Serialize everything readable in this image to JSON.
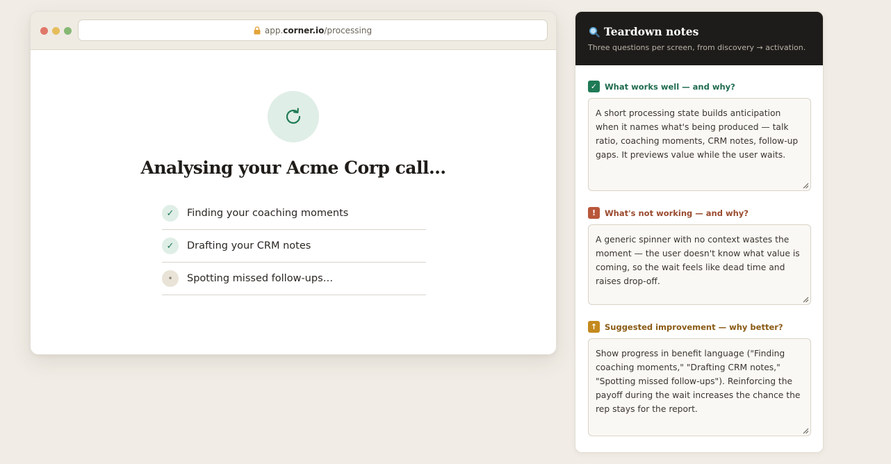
{
  "browser": {
    "url_prefix": "app.",
    "url_host": "corner.io",
    "url_path": "/processing",
    "heading": "Analysing your Acme Corp call…",
    "steps": [
      {
        "label": "Finding your coaching moments",
        "status": "done",
        "icon": "✓"
      },
      {
        "label": "Drafting your CRM notes",
        "status": "done",
        "icon": "✓"
      },
      {
        "label": "Spotting missed follow-ups…",
        "status": "pending",
        "icon": "•"
      }
    ]
  },
  "panel": {
    "title": "Teardown notes",
    "subtitle": "Three questions per screen, from discovery → activation.",
    "questions": [
      {
        "label": "What works well — and why?",
        "badge": "✓",
        "answer": "A short processing state builds anticipation when it names what's being produced — talk ratio, coaching moments, CRM notes, follow-up gaps. It previews value while the user waits."
      },
      {
        "label": "What's not working — and why?",
        "badge": "!",
        "answer": "A generic spinner with no context wastes the moment — the user doesn't know what value is coming, so the wait feels like dead time and raises drop-off."
      },
      {
        "label": "Suggested improvement — why better?",
        "badge": "↑",
        "answer": "Show progress in benefit language (\"Finding coaching moments,\" \"Drafting CRM notes,\" \"Spotting missed follow-ups\"). Reinforcing the payoff during the wait increases the chance the rep stays for the report."
      }
    ]
  },
  "colors": {
    "background": "#f1ede6",
    "success": "#1f7a55",
    "warning": "#b9573a",
    "improve": "#c48a1f",
    "panel_header": "#1e1c1a"
  },
  "icons": [
    "lock-icon",
    "refresh-icon",
    "check-icon",
    "magnifier-icon",
    "resize-grip-icon"
  ]
}
